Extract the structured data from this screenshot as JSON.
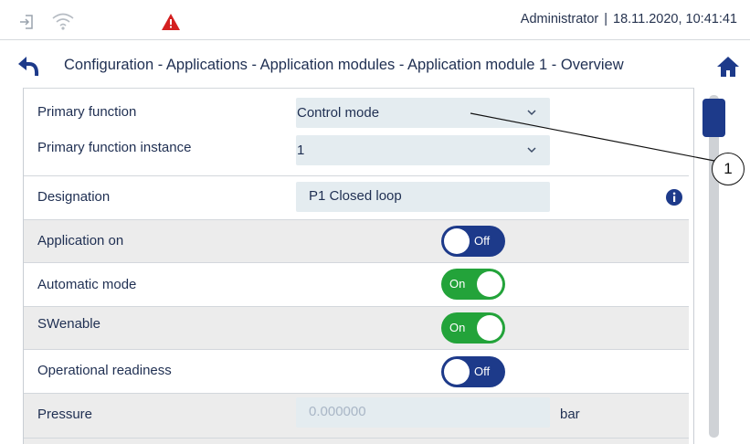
{
  "header": {
    "user": "Administrator",
    "datetime": "18.11.2020, 10:41:41",
    "icons": [
      "login-icon",
      "wifi-icon",
      "warning-icon"
    ]
  },
  "nav": {
    "back_icon": "back-arrow-icon",
    "breadcrumb": "Configuration - Applications - Application modules - Application module 1 - Overview",
    "home_icon": "home-icon"
  },
  "rows": {
    "primary_function": {
      "label": "Primary function",
      "value": "Control mode"
    },
    "primary_function_instance": {
      "label": "Primary function instance",
      "value": "1"
    },
    "designation": {
      "label": "Designation",
      "value": "P1 Closed loop"
    },
    "application_on": {
      "label": "Application on",
      "state": "Off"
    },
    "automatic_mode": {
      "label": "Automatic mode",
      "state": "On"
    },
    "swenable": {
      "label": "SWenable",
      "state": "On"
    },
    "operational_readiness": {
      "label": "Operational readiness",
      "state": "Off"
    },
    "pressure": {
      "label": "Pressure",
      "placeholder": "0.000000",
      "unit": "bar"
    }
  },
  "callout": {
    "number": "1"
  },
  "colors": {
    "accent": "#1d3a8a",
    "on": "#23a33a",
    "warning": "#d42020"
  }
}
